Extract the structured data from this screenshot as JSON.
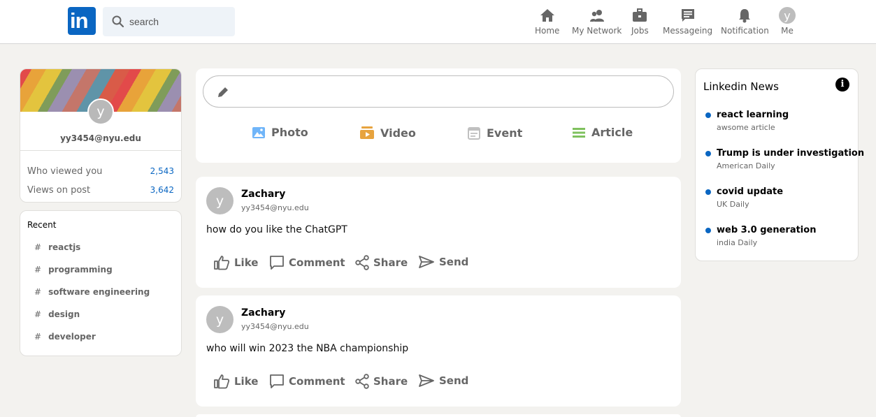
{
  "header": {
    "logo_text": "in",
    "search_placeholder": "search",
    "nav": [
      {
        "label": "Home",
        "icon": "home-icon"
      },
      {
        "label": "My Network",
        "icon": "people-icon"
      },
      {
        "label": "Jobs",
        "icon": "briefcase-icon"
      },
      {
        "label": "Messageing",
        "icon": "message-icon"
      },
      {
        "label": "Notification",
        "icon": "bell-icon"
      },
      {
        "label": "Me",
        "icon": "avatar",
        "avatar_letter": "y"
      }
    ]
  },
  "profile": {
    "avatar_letter": "y",
    "email": "yy3454@nyu.edu",
    "stats": [
      {
        "label": "Who viewed you",
        "value": "2,543"
      },
      {
        "label": "Views on post",
        "value": "3,642"
      }
    ]
  },
  "recent": {
    "title": "Recent",
    "items": [
      "reactjs",
      "programming",
      "software engineering",
      "design",
      "developer"
    ],
    "hash": "#"
  },
  "share": {
    "actions": [
      {
        "label": "Photo",
        "icon": "photo-icon",
        "color": "#70b5f9"
      },
      {
        "label": "Video",
        "icon": "video-icon",
        "color": "#e7a33e"
      },
      {
        "label": "Event",
        "icon": "calendar-icon",
        "color": "#c0c0c0"
      },
      {
        "label": "Article",
        "icon": "article-icon",
        "color": "#7fc15e"
      }
    ]
  },
  "posts": [
    {
      "avatar_letter": "y",
      "name": "Zachary",
      "email": "yy3454@nyu.edu",
      "text": "how do you like the ChatGPT"
    },
    {
      "avatar_letter": "y",
      "name": "Zachary",
      "email": "yy3454@nyu.edu",
      "text": "who will win 2023 the NBA championship"
    }
  ],
  "post_actions": [
    "Like",
    "Comment",
    "Share",
    "Send"
  ],
  "news": {
    "title": "Linkedin News",
    "info_glyph": "i",
    "items": [
      {
        "headline": "react learning",
        "source": "awsome article"
      },
      {
        "headline": "Trump is under investigation",
        "source": "American Daily"
      },
      {
        "headline": "covid update",
        "source": "UK Daily"
      },
      {
        "headline": "web 3.0 generation",
        "source": "india Daily"
      }
    ]
  },
  "colors": {
    "brand": "#0a66c2",
    "background": "#f3f2ef"
  }
}
